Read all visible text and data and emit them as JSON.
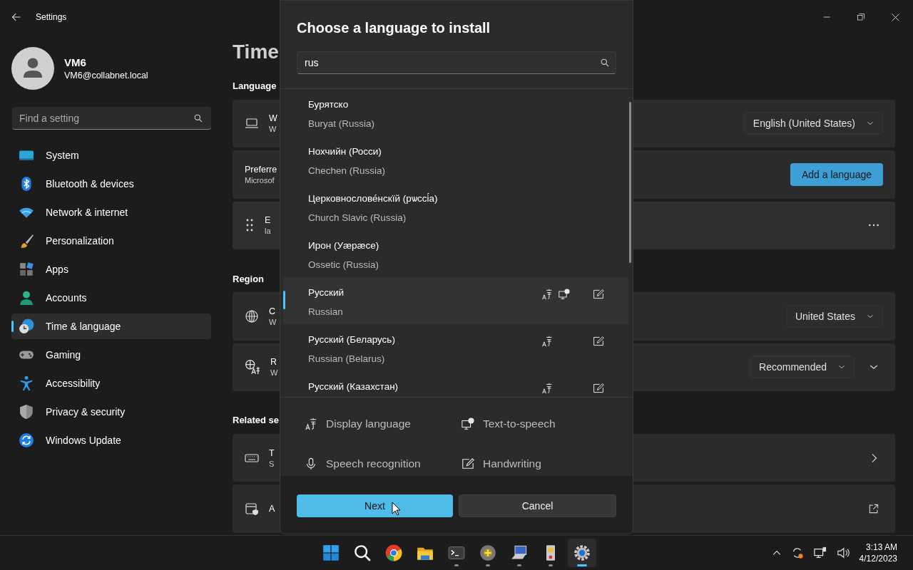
{
  "window": {
    "title": "Settings"
  },
  "profile": {
    "name": "VM6",
    "email": "VM6@collabnet.local"
  },
  "search": {
    "placeholder": "Find a setting"
  },
  "nav": [
    {
      "kind": "system",
      "label": "System",
      "selected": false
    },
    {
      "kind": "bluetooth",
      "label": "Bluetooth & devices",
      "selected": false
    },
    {
      "kind": "network",
      "label": "Network & internet",
      "selected": false
    },
    {
      "kind": "personalization",
      "label": "Personalization",
      "selected": false
    },
    {
      "kind": "apps",
      "label": "Apps",
      "selected": false
    },
    {
      "kind": "accounts",
      "label": "Accounts",
      "selected": false
    },
    {
      "kind": "time",
      "label": "Time & language",
      "selected": true
    },
    {
      "kind": "gaming",
      "label": "Gaming",
      "selected": false
    },
    {
      "kind": "accessibility",
      "label": "Accessibility",
      "selected": false
    },
    {
      "kind": "privacy",
      "label": "Privacy & security",
      "selected": false
    },
    {
      "kind": "update",
      "label": "Windows Update",
      "selected": false
    }
  ],
  "page": {
    "title": "Time",
    "sections": [
      {
        "heading": "Language",
        "cards": [
          {
            "kind": "dropdown",
            "title": "W",
            "subtitle": "W",
            "control": "English (United States)"
          },
          {
            "kind": "button",
            "title": "Preferre",
            "subtitle": "Microsof",
            "control": "Add a language"
          },
          {
            "kind": "more",
            "title": "E",
            "subtitle": "la"
          }
        ]
      },
      {
        "heading": "Region",
        "cards": [
          {
            "kind": "dropdown",
            "title": "C",
            "subtitle": "W",
            "control": "United States"
          },
          {
            "kind": "dropdown-expand",
            "title": "R",
            "subtitle": "W",
            "control": "Recommended"
          }
        ]
      },
      {
        "heading": "Related se",
        "cards": [
          {
            "kind": "chevron",
            "title": "T",
            "subtitle": "S"
          },
          {
            "kind": "external",
            "title": "A"
          }
        ]
      }
    ]
  },
  "dialog": {
    "title": "Choose a language to install",
    "search_value": "rus",
    "languages": [
      {
        "name": "Бурятско",
        "english": "Buryat (Russia)",
        "selected": false,
        "features": {
          "display": false,
          "tts": false,
          "speech": false,
          "handwriting": false
        }
      },
      {
        "name": "Нохчийн (Росси)",
        "english": "Chechen (Russia)",
        "selected": false,
        "features": {
          "display": false,
          "tts": false,
          "speech": false,
          "handwriting": false
        }
      },
      {
        "name": "Церковнослове́нскїй (рѡссі́а)",
        "english": "Church Slavic (Russia)",
        "selected": false,
        "features": {
          "display": false,
          "tts": false,
          "speech": false,
          "handwriting": false
        }
      },
      {
        "name": "Ирон (Уæрæсе)",
        "english": "Ossetic (Russia)",
        "selected": false,
        "features": {
          "display": false,
          "tts": false,
          "speech": false,
          "handwriting": false
        }
      },
      {
        "name": "Русский",
        "english": "Russian",
        "selected": true,
        "features": {
          "display": true,
          "tts": true,
          "speech": false,
          "handwriting": true
        }
      },
      {
        "name": "Русский (Беларусь)",
        "english": "Russian (Belarus)",
        "selected": false,
        "features": {
          "display": true,
          "tts": false,
          "speech": false,
          "handwriting": true
        }
      },
      {
        "name": "Русский (Казахстан)",
        "selected": false,
        "features": {
          "display": true,
          "tts": false,
          "speech": false,
          "handwriting": true
        }
      }
    ],
    "legend": [
      {
        "kind": "display",
        "label": "Display language"
      },
      {
        "kind": "tts",
        "label": "Text-to-speech"
      },
      {
        "kind": "speech",
        "label": "Speech recognition"
      },
      {
        "kind": "handwriting",
        "label": "Handwriting"
      }
    ],
    "buttons": [
      {
        "kind": "primary",
        "label": "Next"
      },
      {
        "kind": "secondary",
        "label": "Cancel"
      }
    ]
  },
  "taskbar": {
    "apps": [
      {
        "kind": "start",
        "running": false,
        "selected": false
      },
      {
        "kind": "search",
        "running": false,
        "selected": false
      },
      {
        "kind": "browser",
        "running": false,
        "selected": false
      },
      {
        "kind": "folder",
        "running": false,
        "selected": false
      },
      {
        "kind": "terminal",
        "running": true,
        "selected": false
      },
      {
        "kind": "disc",
        "running": true,
        "selected": false
      },
      {
        "kind": "computer",
        "running": true,
        "selected": false
      },
      {
        "kind": "device",
        "running": true,
        "selected": false
      },
      {
        "kind": "settings",
        "running": true,
        "selected": true
      }
    ],
    "time": "3:13 AM",
    "date": "4/12/2023"
  }
}
